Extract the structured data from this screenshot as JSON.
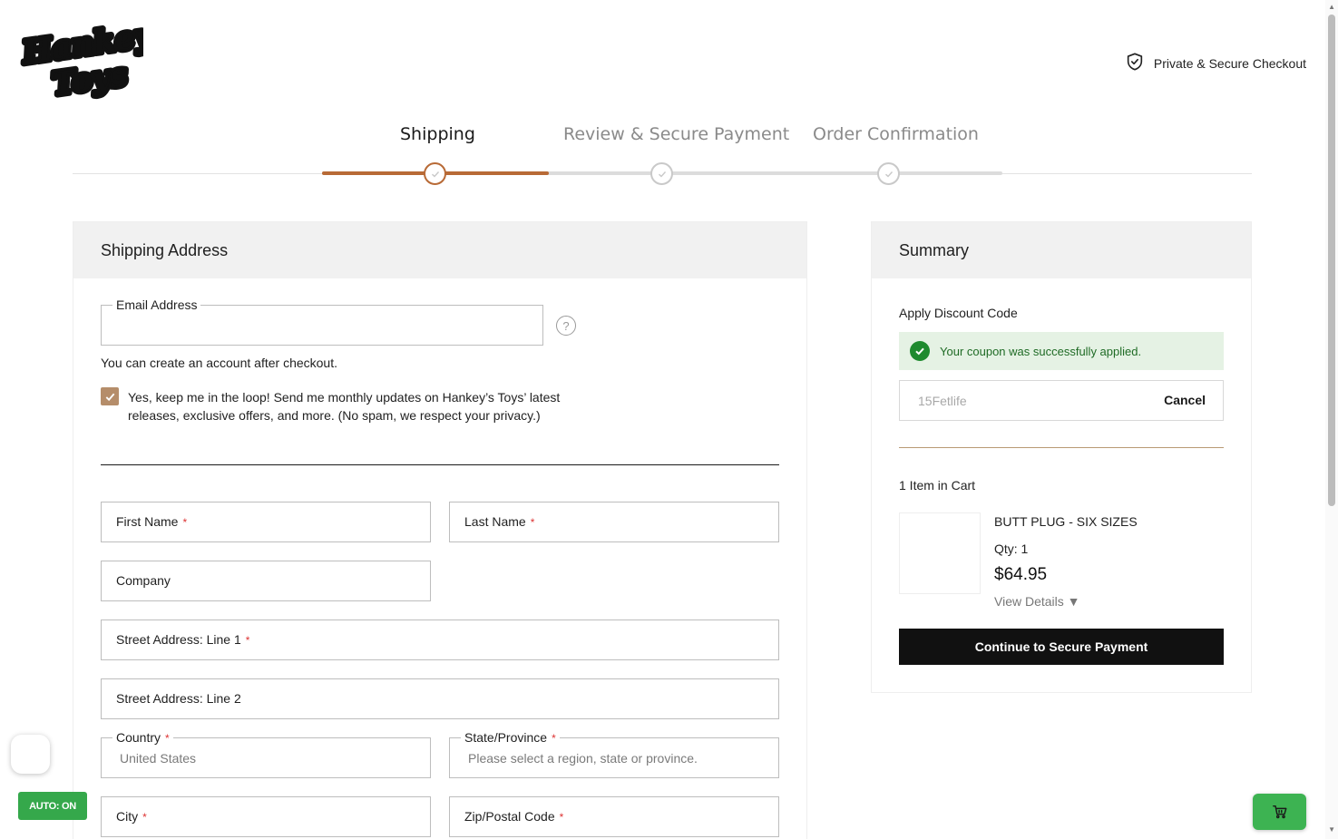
{
  "header": {
    "logo_line1": "Hankey's",
    "logo_line2": "Toys",
    "secure_label": "Private & Secure Checkout"
  },
  "steps": [
    {
      "label": "Shipping",
      "state": "active"
    },
    {
      "label": "Review & Secure Payment",
      "state": "pending"
    },
    {
      "label": "Order Confirmation",
      "state": "pending"
    }
  ],
  "shipping": {
    "title": "Shipping Address",
    "email_label": "Email Address",
    "help_icon": "?",
    "account_note": "You can create an account after checkout.",
    "newsletter_text": "Yes, keep me in the loop! Send me monthly updates on Hankey’s Toys’ latest releases, exclusive offers, and more. (No spam, we respect your privacy.)",
    "newsletter_checked": true,
    "required_mark": "*",
    "fields": {
      "first_name": "First Name",
      "last_name": "Last Name",
      "company": "Company",
      "street1": "Street Address: Line 1",
      "street2": "Street Address: Line 2",
      "country_label": "Country",
      "country_value": "United States",
      "state_label": "State/Province",
      "state_placeholder": "Please select a region, state or province.",
      "city": "City",
      "zip": "Zip/Postal Code"
    }
  },
  "summary": {
    "title": "Summary",
    "discount_label": "Apply Discount Code",
    "success_message": "Your coupon was successfully applied.",
    "coupon_code": "15Fetlife",
    "cancel_label": "Cancel",
    "cart_count": "1 Item in Cart",
    "item": {
      "name": "BUTT PLUG - SIX SIZES",
      "qty": "Qty: 1",
      "price": "$64.95",
      "view_details": "View Details ▼"
    },
    "cta_label": "Continue to Secure Payment"
  },
  "widgets": {
    "auto_label": "AUTO: ON"
  },
  "colors": {
    "accent": "#b86a36",
    "success_bg": "#e5f2e4",
    "success_icon": "#1e8a2e",
    "cta_bg": "#111111",
    "widget_green": "#35a84b"
  }
}
